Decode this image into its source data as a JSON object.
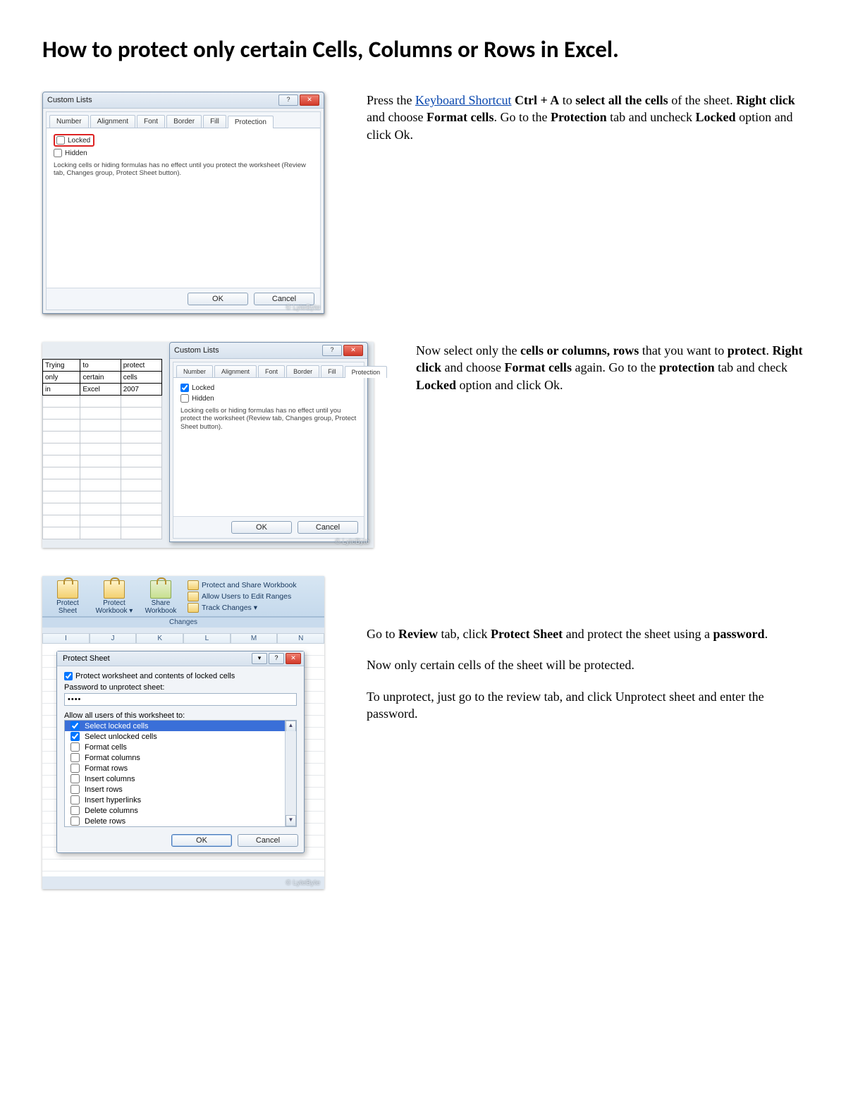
{
  "title": "How to protect only certain Cells, Columns or Rows in Excel.",
  "watermark": "© LyteByte",
  "step1": {
    "dialog_title": "Custom Lists",
    "tabs": [
      "Number",
      "Alignment",
      "Font",
      "Border",
      "Fill",
      "Protection"
    ],
    "locked_label": "Locked",
    "hidden_label": "Hidden",
    "infoline": "Locking cells or hiding formulas has no effect until you protect the worksheet (Review tab, Changes group, Protect Sheet button).",
    "ok": "OK",
    "cancel": "Cancel",
    "text_pre": "Press the ",
    "link": "Keyboard Shortcut",
    "t1": " Ctrl + A",
    "t2": " to ",
    "t3": "select all the cells",
    "t4": " of the sheet. ",
    "t5": "Right click",
    "t6": " and choose ",
    "t7": "Format cells",
    "t8": ". Go to the ",
    "t9": "Protection",
    "t10": " tab and uncheck ",
    "t11": "Locked",
    "t12": " option and click Ok."
  },
  "step2": {
    "sheet_rows": [
      [
        "Trying",
        "to",
        "protect"
      ],
      [
        "only",
        "certain",
        "cells"
      ],
      [
        "in",
        "Excel",
        "2007"
      ]
    ],
    "dialog_title": "Custom Lists",
    "tabs": [
      "Number",
      "Alignment",
      "Font",
      "Border",
      "Fill",
      "Protection"
    ],
    "locked_label": "Locked",
    "hidden_label": "Hidden",
    "infoline": "Locking cells or hiding formulas has no effect until you protect the worksheet (Review tab, Changes group, Protect Sheet button).",
    "ok": "OK",
    "cancel": "Cancel",
    "p1a": "Now select only the ",
    "p1b": "cells or columns, rows",
    "p1c": " that you want to ",
    "p1d": "protect",
    "p1e": ". ",
    "p1f": "Right click",
    "p1g": " and choose ",
    "p1h": "Format cells",
    "p1i": " again. Go to the ",
    "p1j": "protection",
    "p1k": " tab and check ",
    "p1l": "Locked",
    "p1m": " option and click Ok."
  },
  "step3": {
    "ribbon": {
      "protect_sheet": "Protect Sheet",
      "protect_workbook": "Protect Workbook",
      "share_workbook": "Share Workbook",
      "protect_share": "Protect and Share Workbook",
      "allow_users": "Allow Users to Edit Ranges",
      "track_changes": "Track Changes",
      "group_label": "Changes"
    },
    "cols": [
      "I",
      "J",
      "K",
      "L",
      "M",
      "N"
    ],
    "dlg_title": "Protect Sheet",
    "chk_main": "Protect worksheet and contents of locked cells",
    "pw_label": "Password to unprotect sheet:",
    "pw_value": "••••",
    "allow_label": "Allow all users of this worksheet to:",
    "perms": [
      "Select locked cells",
      "Select unlocked cells",
      "Format cells",
      "Format columns",
      "Format rows",
      "Insert columns",
      "Insert rows",
      "Insert hyperlinks",
      "Delete columns",
      "Delete rows"
    ],
    "ok": "OK",
    "cancel": "Cancel",
    "p1a": "Go to ",
    "p1b": "Review",
    "p1c": " tab, click ",
    "p1d": "Protect Sheet",
    "p1e": " and protect the sheet using a ",
    "p1f": "password",
    "p1g": ".",
    "p2": "Now only certain cells of the sheet will be protected.",
    "p3": "To unprotect, just go to the review tab, and click Unprotect sheet and enter the password."
  }
}
